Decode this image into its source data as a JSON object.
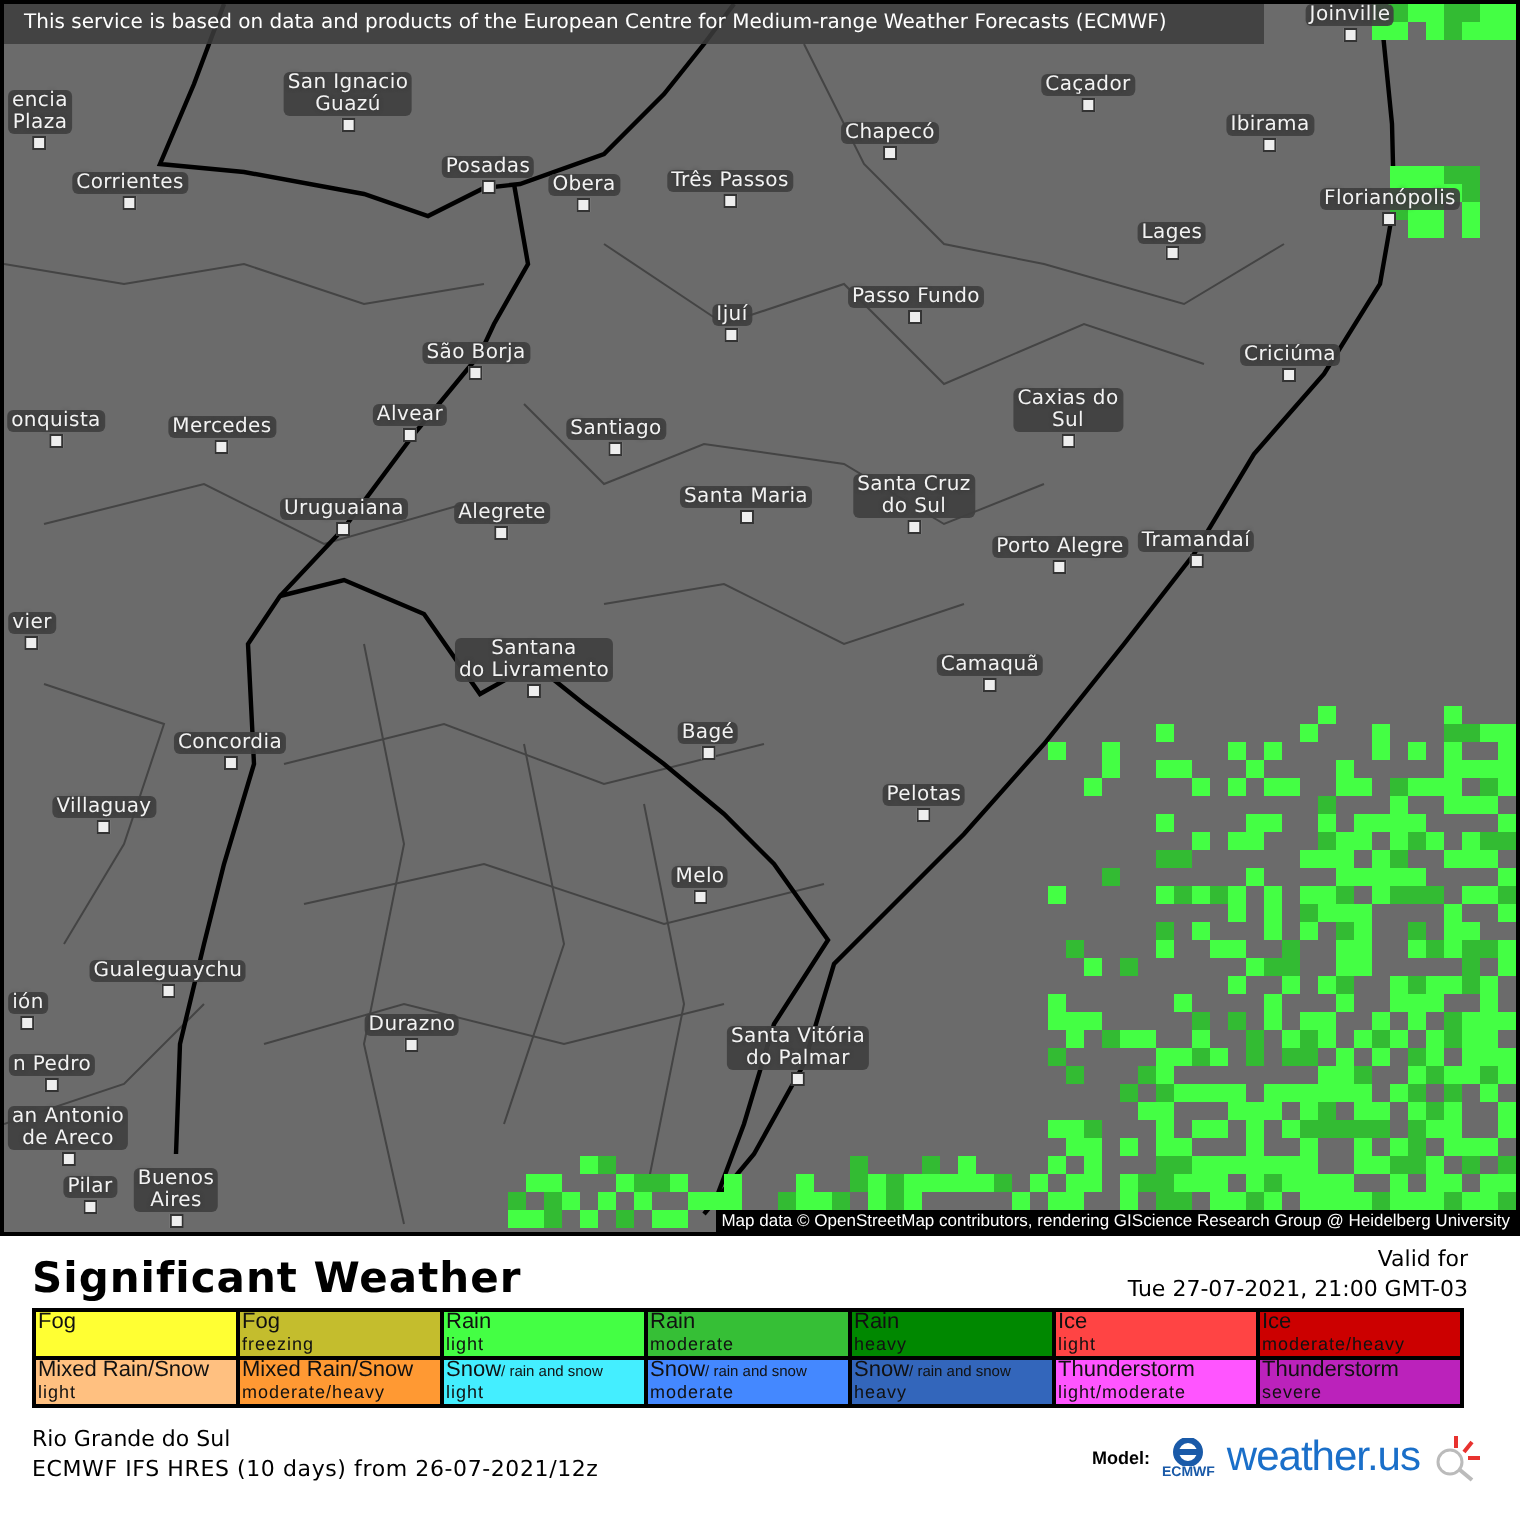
{
  "banner": "This service is based on data and products of the European Centre for Medium-range Weather Forecasts (ECMWF)",
  "cities": [
    {
      "lines": [
        "Joinville"
      ]
    },
    {
      "lines": [
        "encia",
        "Plaza"
      ]
    },
    {
      "lines": [
        "San Ignacio",
        "Guazú"
      ]
    },
    {
      "lines": [
        "Chapecó"
      ]
    },
    {
      "lines": [
        "Caçador"
      ]
    },
    {
      "lines": [
        "Ibirama"
      ]
    },
    {
      "lines": [
        "Corrientes"
      ]
    },
    {
      "lines": [
        "Posadas"
      ]
    },
    {
      "lines": [
        "Obera"
      ]
    },
    {
      "lines": [
        "Três Passos"
      ]
    },
    {
      "lines": [
        "Florianópolis"
      ]
    },
    {
      "lines": [
        "Lages"
      ]
    },
    {
      "lines": [
        "Ijuí"
      ]
    },
    {
      "lines": [
        "Passo Fundo"
      ]
    },
    {
      "lines": [
        "São Borja"
      ]
    },
    {
      "lines": [
        "Criciúma"
      ]
    },
    {
      "lines": [
        "onquista"
      ]
    },
    {
      "lines": [
        "Mercedes"
      ]
    },
    {
      "lines": [
        "Alvear"
      ]
    },
    {
      "lines": [
        "Santiago"
      ]
    },
    {
      "lines": [
        "Caxias do",
        "Sul"
      ]
    },
    {
      "lines": [
        "Uruguaiana"
      ]
    },
    {
      "lines": [
        "Alegrete"
      ]
    },
    {
      "lines": [
        "Santa Maria"
      ]
    },
    {
      "lines": [
        "Santa Cruz",
        "do Sul"
      ]
    },
    {
      "lines": [
        "Porto Alegre"
      ]
    },
    {
      "lines": [
        "Tramandaí"
      ]
    },
    {
      "lines": [
        "vier"
      ]
    },
    {
      "lines": [
        "Santana",
        "do Livramento"
      ]
    },
    {
      "lines": [
        "Camaquã"
      ]
    },
    {
      "lines": [
        "Concordia"
      ]
    },
    {
      "lines": [
        "Bagé"
      ]
    },
    {
      "lines": [
        "Villaguay"
      ]
    },
    {
      "lines": [
        "Pelotas"
      ]
    },
    {
      "lines": [
        "Melo"
      ]
    },
    {
      "lines": [
        "Gualeguaychu"
      ]
    },
    {
      "lines": [
        "ión"
      ]
    },
    {
      "lines": [
        "n Pedro"
      ]
    },
    {
      "lines": [
        "Durazno"
      ]
    },
    {
      "lines": [
        "Santa Vitória",
        "do Palmar"
      ]
    },
    {
      "lines": [
        "an Antonio",
        "de Areco"
      ]
    },
    {
      "lines": [
        "Pilar"
      ]
    },
    {
      "lines": [
        "Buenos",
        "Aires"
      ]
    }
  ],
  "attribution": "Map data © OpenStreetMap contributors, rendering GIScience Research Group @ Heidelberg University",
  "title": "Significant Weather",
  "valid": {
    "label": "Valid for",
    "time": "Tue 27-07-2021, 21:00 GMT-03"
  },
  "legend": [
    [
      {
        "label": "Fog",
        "color": "#ffff33"
      },
      {
        "label": "Fog",
        "sublabel": "freezing",
        "color": "#c4bd2d"
      },
      {
        "label": "Rain",
        "sublabel": "light",
        "color": "#44ff44"
      },
      {
        "label": "Rain",
        "sublabel": "moderate",
        "color": "#36bf36"
      },
      {
        "label": "Rain",
        "sublabel": "heavy",
        "color": "#008800"
      },
      {
        "label": "Ice",
        "sublabel": "light",
        "color": "#ff4444"
      },
      {
        "label": "Ice",
        "sublabel": "moderate/heavy",
        "color": "#cc0000"
      }
    ],
    [
      {
        "label": "Mixed Rain/Snow",
        "sublabel": "light",
        "color": "#ffc080"
      },
      {
        "label": "Mixed Rain/Snow",
        "sublabel": "moderate/heavy",
        "color": "#ff9933"
      },
      {
        "label": "Snow",
        "note": "/ rain and snow",
        "sublabel": "light",
        "color": "#44eeff"
      },
      {
        "label": "Snow",
        "note": "/ rain and snow",
        "sublabel": "moderate",
        "color": "#4488ff"
      },
      {
        "label": "Snow",
        "note": "/ rain and snow",
        "sublabel": "heavy",
        "color": "#3366bb"
      },
      {
        "label": "Thunderstorm",
        "sublabel": "light/moderate",
        "color": "#ff55ff"
      },
      {
        "label": "Thunderstorm",
        "sublabel": "severe",
        "color": "#bb22bb"
      }
    ]
  ],
  "region": "Rio Grande do Sul",
  "model_run": "ECMWF IFS HRES (10 days) from 26-07-2021/12z",
  "model_label": "Model:",
  "ecmwf_logo": "ECMWF",
  "brand": "weather.us"
}
